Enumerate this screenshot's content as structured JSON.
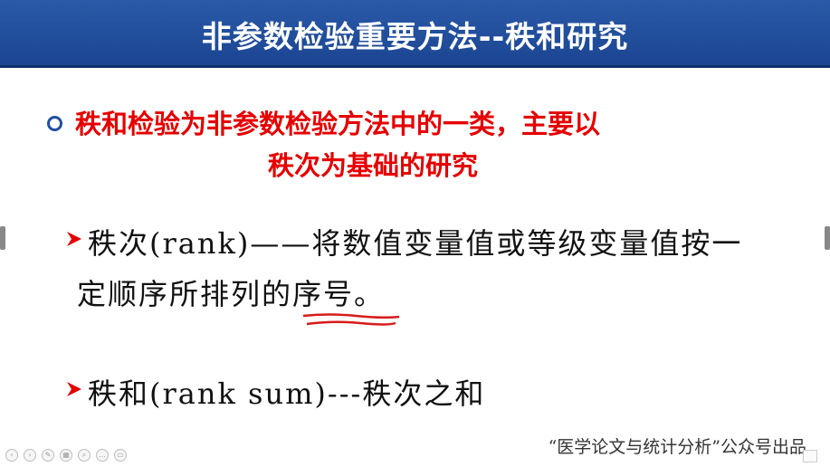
{
  "slide": {
    "title": "非参数检验重要方法--秩和研究",
    "bullet_main": {
      "line1": "秩和检验为非参数检验方法中的一类，主要以",
      "line2": "秩次为基础的研究"
    },
    "items": [
      {
        "line1": "秩次(rank)——将数值变量值或等级变量值按一",
        "line2": "定顺序所排列的序号。"
      },
      {
        "line1": "秩和(rank sum)---秩次之和"
      }
    ],
    "footer": "“医学论文与统计分析”公众号出品"
  },
  "colors": {
    "title_bar": "#1b4592",
    "highlight_text": "#e60000",
    "arrow": "#e60000",
    "underline": "#d81b1b"
  }
}
